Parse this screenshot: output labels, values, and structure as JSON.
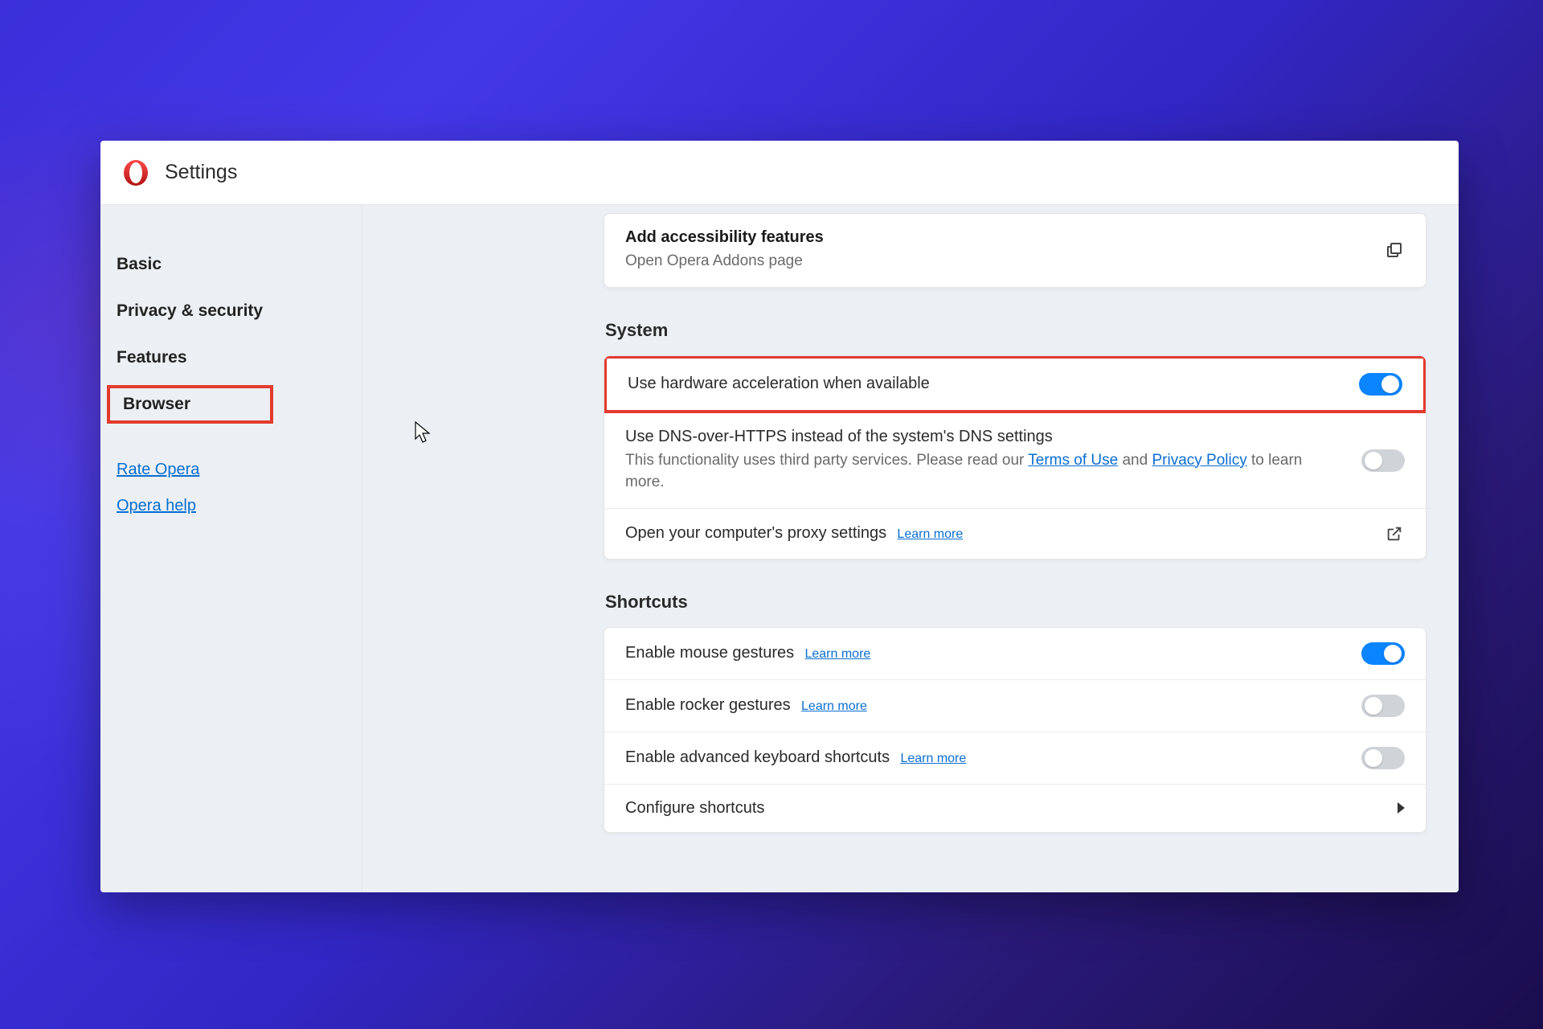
{
  "header": {
    "title": "Settings"
  },
  "sidebar": {
    "items": [
      {
        "label": "Basic",
        "bold": true
      },
      {
        "label": "Privacy & security",
        "bold": true
      },
      {
        "label": "Features",
        "bold": true
      },
      {
        "label": "Browser",
        "highlighted": true
      }
    ],
    "links": [
      {
        "label": "Rate Opera"
      },
      {
        "label": "Opera help"
      }
    ]
  },
  "accessibility_card": {
    "title": "Add accessibility features",
    "subtitle": "Open Opera Addons page"
  },
  "system": {
    "heading": "System",
    "hw_accel": {
      "label": "Use hardware acceleration when available",
      "on": true,
      "highlighted": true
    },
    "dns": {
      "label": "Use DNS-over-HTTPS instead of the system's DNS settings",
      "desc_prefix": "This functionality uses third party services. Please read our ",
      "terms": "Terms of Use",
      "and": " and ",
      "privacy": "Privacy Policy",
      "desc_suffix": " to learn more.",
      "on": false
    },
    "proxy": {
      "label": "Open your computer's proxy settings",
      "learn_more": "Learn more"
    }
  },
  "shortcuts": {
    "heading": "Shortcuts",
    "mouse": {
      "label": "Enable mouse gestures",
      "learn_more": "Learn more",
      "on": true
    },
    "rocker": {
      "label": "Enable rocker gestures",
      "learn_more": "Learn more",
      "on": false
    },
    "advkb": {
      "label": "Enable advanced keyboard shortcuts",
      "learn_more": "Learn more",
      "on": false
    },
    "configure": {
      "label": "Configure shortcuts"
    }
  }
}
